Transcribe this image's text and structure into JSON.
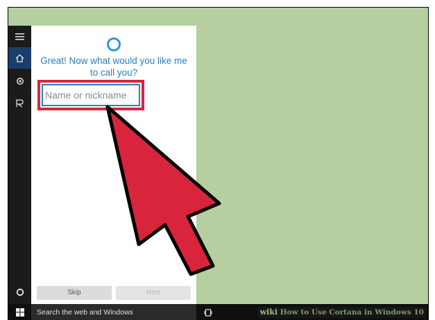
{
  "cortana": {
    "prompt": "Great! Now what would you like me to call you?",
    "name_input": {
      "value": "",
      "placeholder": "Name or nickname"
    },
    "skip_label": "Skip",
    "next_label": "Next"
  },
  "rail": {
    "items": [
      {
        "icon": "hamburger-menu-icon"
      },
      {
        "icon": "home-icon",
        "active": true
      },
      {
        "icon": "notebook-icon"
      },
      {
        "icon": "feedback-icon"
      },
      {
        "icon": "cortana-circle-icon"
      }
    ]
  },
  "taskbar": {
    "search_placeholder": "Search the web and Windows"
  },
  "watermark": {
    "brand": "wiki",
    "text": "How to Use Cortana in Windows 10"
  },
  "colors": {
    "desktop": "#b5cfa0",
    "accent": "#2a7fc2",
    "highlight": "#d8253b",
    "arrow": "#d8253b",
    "rail": "#1b1b1b",
    "taskbar": "#0f0f0f"
  }
}
